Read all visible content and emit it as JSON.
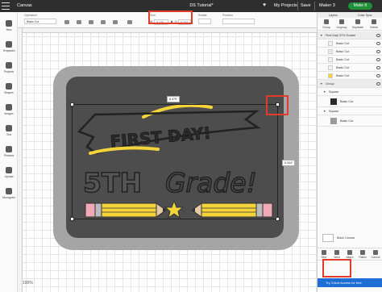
{
  "topbar": {
    "app_title": "Canvas",
    "document_title": "DS Tutorial*",
    "projects_label": "My Projects",
    "save_label": "Save",
    "machine_label": "Maker 3",
    "make_it_label": "Make It"
  },
  "toolbar": {
    "operation_label": "Operation",
    "operation_value": "Basic Cut",
    "size_label": "Size",
    "size_w_label": "W",
    "size_w_value": "8.479",
    "size_h_label": "H",
    "size_h_value": "5.344",
    "rotate_label": "Rotate",
    "position_label": "Position"
  },
  "leftbar": {
    "items": [
      {
        "label": "New",
        "icon": "plus-icon"
      },
      {
        "label": "Templates",
        "icon": "shirt-icon"
      },
      {
        "label": "Projects",
        "icon": "grid-icon"
      },
      {
        "label": "Shapes",
        "icon": "shapes-icon"
      },
      {
        "label": "Images",
        "icon": "lightbulb-icon"
      },
      {
        "label": "Text",
        "icon": "text-icon"
      },
      {
        "label": "Phrases",
        "icon": "speech-icon"
      },
      {
        "label": "Upload",
        "icon": "upload-icon"
      },
      {
        "label": "Monogram",
        "icon": "monogram-icon"
      }
    ]
  },
  "canvas": {
    "width_dim": "8.479\"",
    "height_dim": "5.344\"",
    "zoom_label": "100%"
  },
  "art": {
    "line1": "FIRST DAY!",
    "line2_bold": "5TH",
    "line2_script": "Grade!"
  },
  "right_panel": {
    "tabs": [
      "Layers",
      "Color Sync"
    ],
    "actions": [
      "Group",
      "Ungroup",
      "Duplicate",
      "Delete"
    ],
    "layers": [
      {
        "label": "First Day! 5TH Grade!",
        "type": "group-header"
      },
      {
        "label": "Basic Cut",
        "color": "#f2f2f2"
      },
      {
        "label": "Basic Cut",
        "color": "#e8e8e8"
      },
      {
        "label": "Basic Cut",
        "color": "#f2f2f2"
      },
      {
        "label": "Basic Cut",
        "color": "#f2f2f2"
      },
      {
        "label": "Basic Cut",
        "color": "#f5d33a"
      },
      {
        "label": "Group",
        "type": "group-header"
      },
      {
        "label": "Square",
        "type": "sub-header"
      },
      {
        "label": "Basic Cut",
        "color": "#2b2b2b"
      },
      {
        "label": "Square",
        "type": "sub-header"
      },
      {
        "label": "Basic Cut",
        "color": "#9a9a9a"
      }
    ],
    "blank_label": "Blank Canvas",
    "bottom_actions": [
      "Slice",
      "Weld",
      "Attach",
      "Flatten",
      "Contour"
    ],
    "access_label": "Try Cricut Access for free"
  },
  "colors": {
    "topbar": "#2e2e2e",
    "accent_green": "#1f8f3a",
    "highlight_red": "#e33a2a",
    "chalkboard": "#4d4d4d",
    "frame_gray": "#a5a5a5",
    "yellow": "#f5d33a",
    "pink": "#f2a9b6"
  }
}
